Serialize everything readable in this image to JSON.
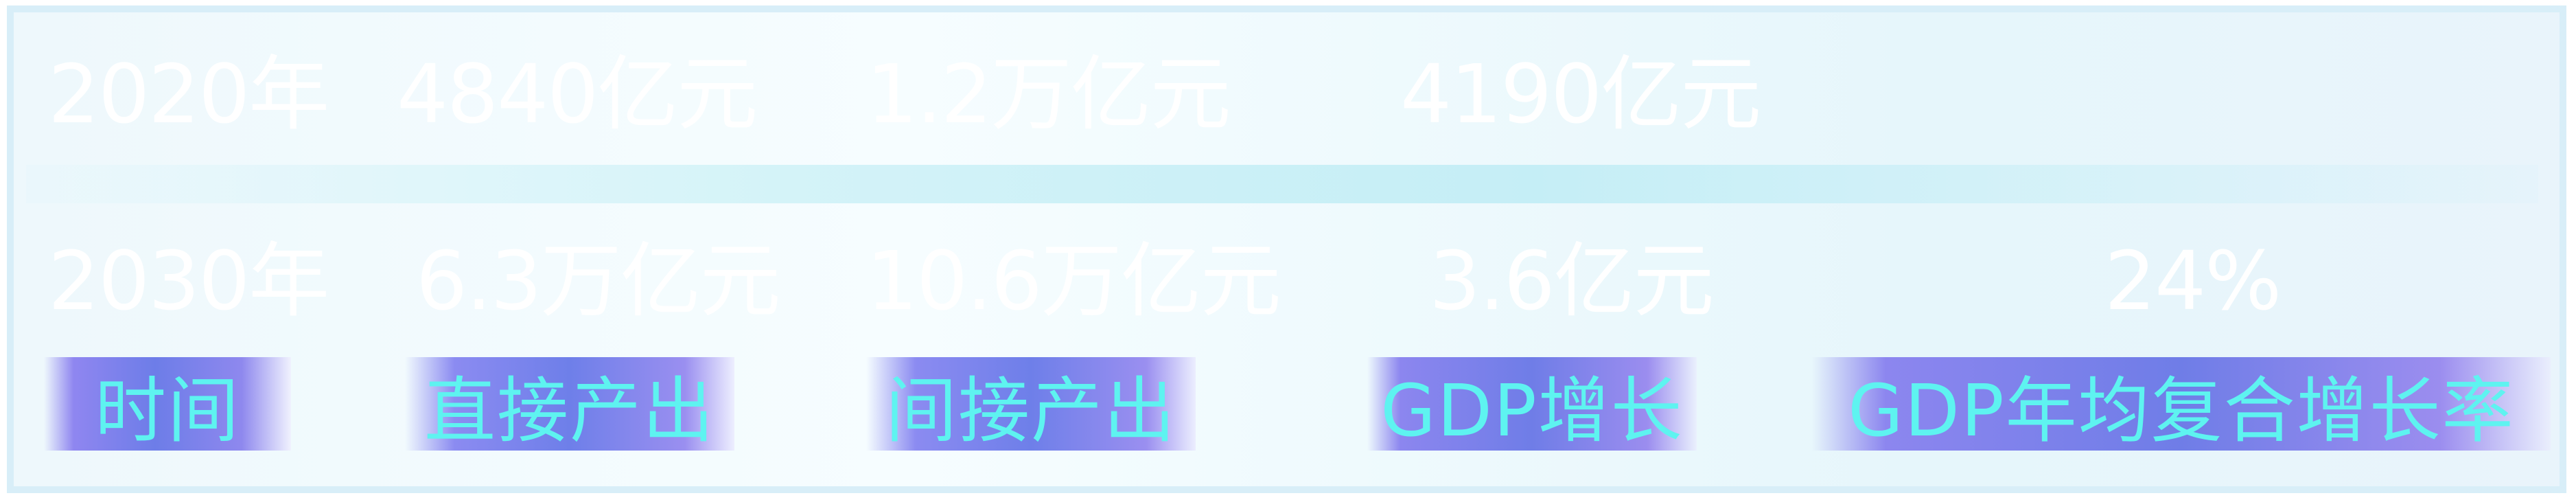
{
  "headers": [
    "时间",
    "直接产出",
    "间接产出",
    "GDP增长",
    "GDP年均复合增长率"
  ],
  "rows": [
    {
      "year": "2020年",
      "direct": "4840亿元",
      "indirect": "1.2万亿元",
      "gdp": "4190亿元",
      "cagr": ""
    },
    {
      "year": "2030年",
      "direct": "6.3万亿元",
      "indirect": "10.6万亿元",
      "gdp": "3.6亿元",
      "cagr": "24%"
    }
  ],
  "colors": {
    "header_text": "#5ef3f0",
    "header_gradient": "#6d7de8",
    "cell_text": "#ffffff",
    "panel_border": "#d8eef8"
  }
}
